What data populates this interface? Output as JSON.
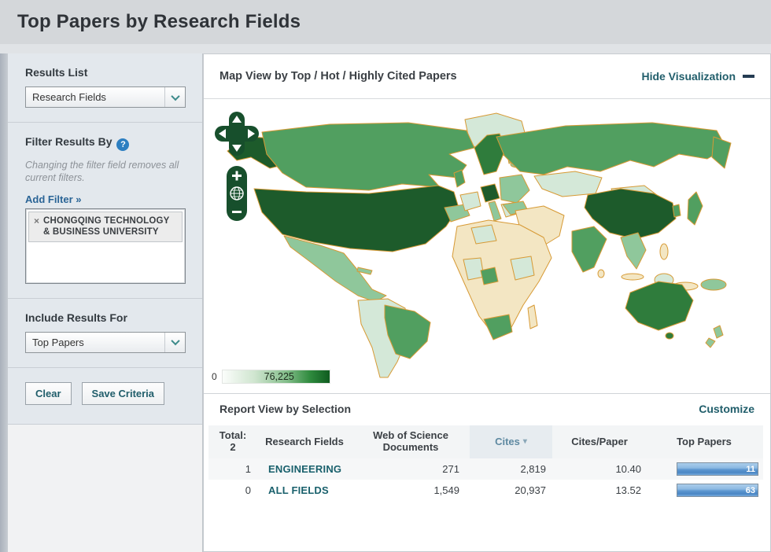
{
  "page": {
    "title": "Top Papers by Research Fields"
  },
  "sidebar": {
    "results_list_label": "Results List",
    "results_list_value": "Research Fields",
    "filter_heading": "Filter Results By",
    "filter_help": "?",
    "filter_note": "Changing the filter field removes all current filters.",
    "add_filter_link": "Add Filter »",
    "filter_tag": {
      "remove": "×",
      "label": "CHONGQING TECHNOLOGY & BUSINESS UNIVERSITY"
    },
    "include_label": "Include Results For",
    "include_value": "Top Papers",
    "clear_button": "Clear",
    "save_button": "Save Criteria"
  },
  "map": {
    "title": "Map View by Top / Hot / Highly Cited Papers",
    "hide_link": "Hide Visualization",
    "legend_min": "0",
    "legend_max": "76,225"
  },
  "report": {
    "title": "Report View by Selection",
    "customize_link": "Customize",
    "table": {
      "total_label": "Total:",
      "total_value": "2",
      "col_field": "Research Fields",
      "col_wos": "Web of Science Documents",
      "col_cites": "Cites",
      "col_cites_sort": "▾",
      "col_cpp": "Cites/Paper",
      "col_top": "Top Papers",
      "rows": [
        {
          "rank": "1",
          "field": "ENGINEERING",
          "wos": "271",
          "cites": "2,819",
          "cpp": "10.40",
          "top": "11"
        },
        {
          "rank": "0",
          "field": "ALL FIELDS",
          "wos": "1,549",
          "cites": "20,937",
          "cpp": "13.52",
          "top": "63"
        }
      ]
    }
  },
  "colors": {
    "accent_teal": "#215e6b",
    "link_blue": "#2a6496",
    "help_blue": "#2d7fc1",
    "map_c1": "#1d5b2b",
    "map_c3": "#519f60",
    "map_stroke": "#d79a35",
    "control_green": "#174f2c",
    "legend_dark": "#0f5c20",
    "bar_mid": "#5d97d0"
  }
}
